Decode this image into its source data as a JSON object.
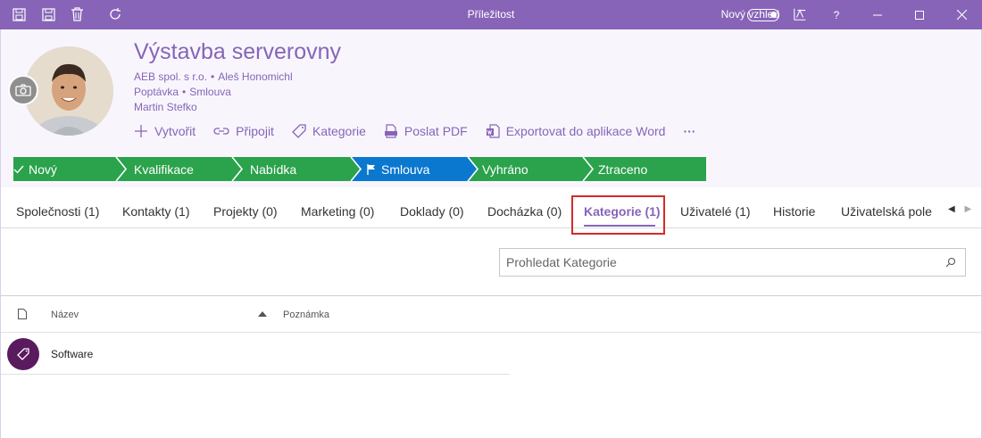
{
  "window": {
    "title": "Příležitost",
    "new_look_label": "Nový vzhled",
    "help_label": "?",
    "new_look_on": true
  },
  "colors": {
    "accent": "#8764b8",
    "stage_green": "#2ba24c",
    "stage_blue": "#0b78d0",
    "highlight": "#d42a2a",
    "category_icon": "#5a1a5e"
  },
  "record": {
    "title": "Výstavba serverovny",
    "company": "AEB spol. s r.o.",
    "contact": "Aleš Honomichl",
    "type": "Poptávka",
    "stage_name": "Smlouva",
    "owner": "Martin Stefko",
    "separator": "•"
  },
  "actions": [
    {
      "label": "Vytvořit",
      "icon": "plus-icon"
    },
    {
      "label": "Připojit",
      "icon": "link-icon"
    },
    {
      "label": "Kategorie",
      "icon": "tag-icon"
    },
    {
      "label": "Poslat PDF",
      "icon": "pdf-icon"
    },
    {
      "label": "Exportovat do aplikace Word",
      "icon": "word-icon"
    },
    {
      "label": "···",
      "icon": "more-icon"
    }
  ],
  "stages": [
    {
      "label": "Nový",
      "status": "done"
    },
    {
      "label": "Kvalifikace",
      "status": "done"
    },
    {
      "label": "Nabídka",
      "status": "done"
    },
    {
      "label": "Smlouva",
      "status": "current"
    },
    {
      "label": "Vyhráno",
      "status": "pending"
    },
    {
      "label": "Ztraceno",
      "status": "pending"
    }
  ],
  "tabs": [
    {
      "label": "Společnosti (1)"
    },
    {
      "label": "Kontakty (1)"
    },
    {
      "label": "Projekty (0)"
    },
    {
      "label": "Marketing (0)"
    },
    {
      "label": "Doklady (0)"
    },
    {
      "label": "Docházka (0)"
    },
    {
      "label": "Kategorie (1)",
      "active": true
    },
    {
      "label": "Uživatelé (1)"
    },
    {
      "label": "Historie"
    },
    {
      "label": "Uživatelská pole"
    }
  ],
  "search": {
    "placeholder": "Prohledat Kategorie",
    "value": ""
  },
  "table": {
    "columns": [
      "Název",
      "Poznámka"
    ],
    "sort_column": "Název",
    "sort_direction": "ascending",
    "rows": [
      {
        "name": "Software",
        "note": ""
      }
    ]
  }
}
